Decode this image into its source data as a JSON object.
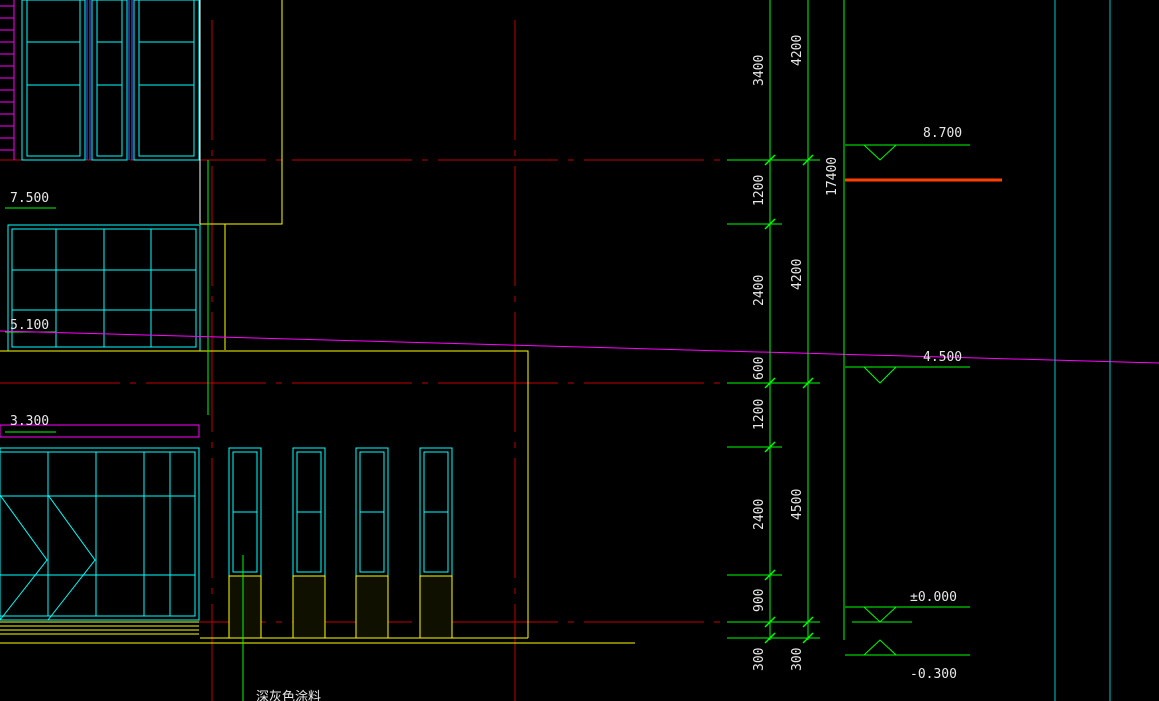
{
  "drawing": {
    "elevation_labels_left": [
      "7.500",
      "5.100",
      "3.300"
    ],
    "elevation_marks_right": [
      "8.700",
      "4.500",
      "±0.000",
      "-0.300"
    ],
    "dims_col1": [
      "3400",
      "1200",
      "2400",
      "600",
      "1200",
      "2400",
      "900",
      "300"
    ],
    "dims_col2": [
      "4200",
      "4200",
      "4500",
      "300"
    ],
    "dim_total": "17400",
    "note_text": "深灰色涂料",
    "colors": {
      "background": "#000000",
      "frame_cyan": "#00ffff",
      "dim_green": "#00ff00",
      "axis_red": "#ff0000",
      "outline_yellow": "#ffff00",
      "magenta": "#ff00ff",
      "highlight_orange": "#ff4000"
    }
  }
}
